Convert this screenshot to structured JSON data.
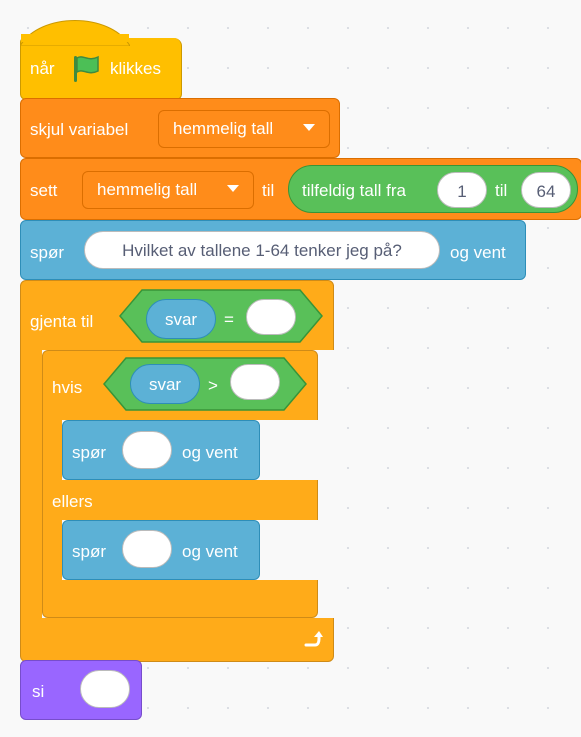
{
  "blocks": {
    "when_flag": {
      "prefix": "når",
      "suffix": "klikkes",
      "icon": "green-flag-icon"
    },
    "hide_variable": {
      "label": "skjul variabel",
      "variable": "hemmelig tall"
    },
    "set_variable": {
      "label": "sett",
      "variable": "hemmelig tall",
      "to": "til",
      "random": {
        "label": "tilfeldig tall fra",
        "from": "1",
        "to_label": "til",
        "to": "64"
      }
    },
    "ask_1": {
      "label": "spør",
      "question": "Hvilket av tallene 1-64 tenker jeg på?",
      "suffix": "og vent"
    },
    "repeat_until": {
      "label": "gjenta til",
      "var": "svar",
      "operator": "=",
      "value": "",
      "loop_icon": "loop-arrow-icon"
    },
    "if_else": {
      "label": "hvis",
      "var": "svar",
      "operator": ">",
      "value": "",
      "else_label": "ellers"
    },
    "ask_2": {
      "label": "spør",
      "value": "",
      "suffix": "og vent"
    },
    "ask_3": {
      "label": "spør",
      "value": "",
      "suffix": "og vent"
    },
    "say": {
      "label": "si",
      "value": ""
    }
  },
  "colors": {
    "events": "#FFBF00",
    "variables": "#FF8C1A",
    "sensing": "#5CB1D6",
    "control": "#FFAB19",
    "operators": "#59C059",
    "looks": "#9966FF",
    "background": "#F9F9F9"
  }
}
